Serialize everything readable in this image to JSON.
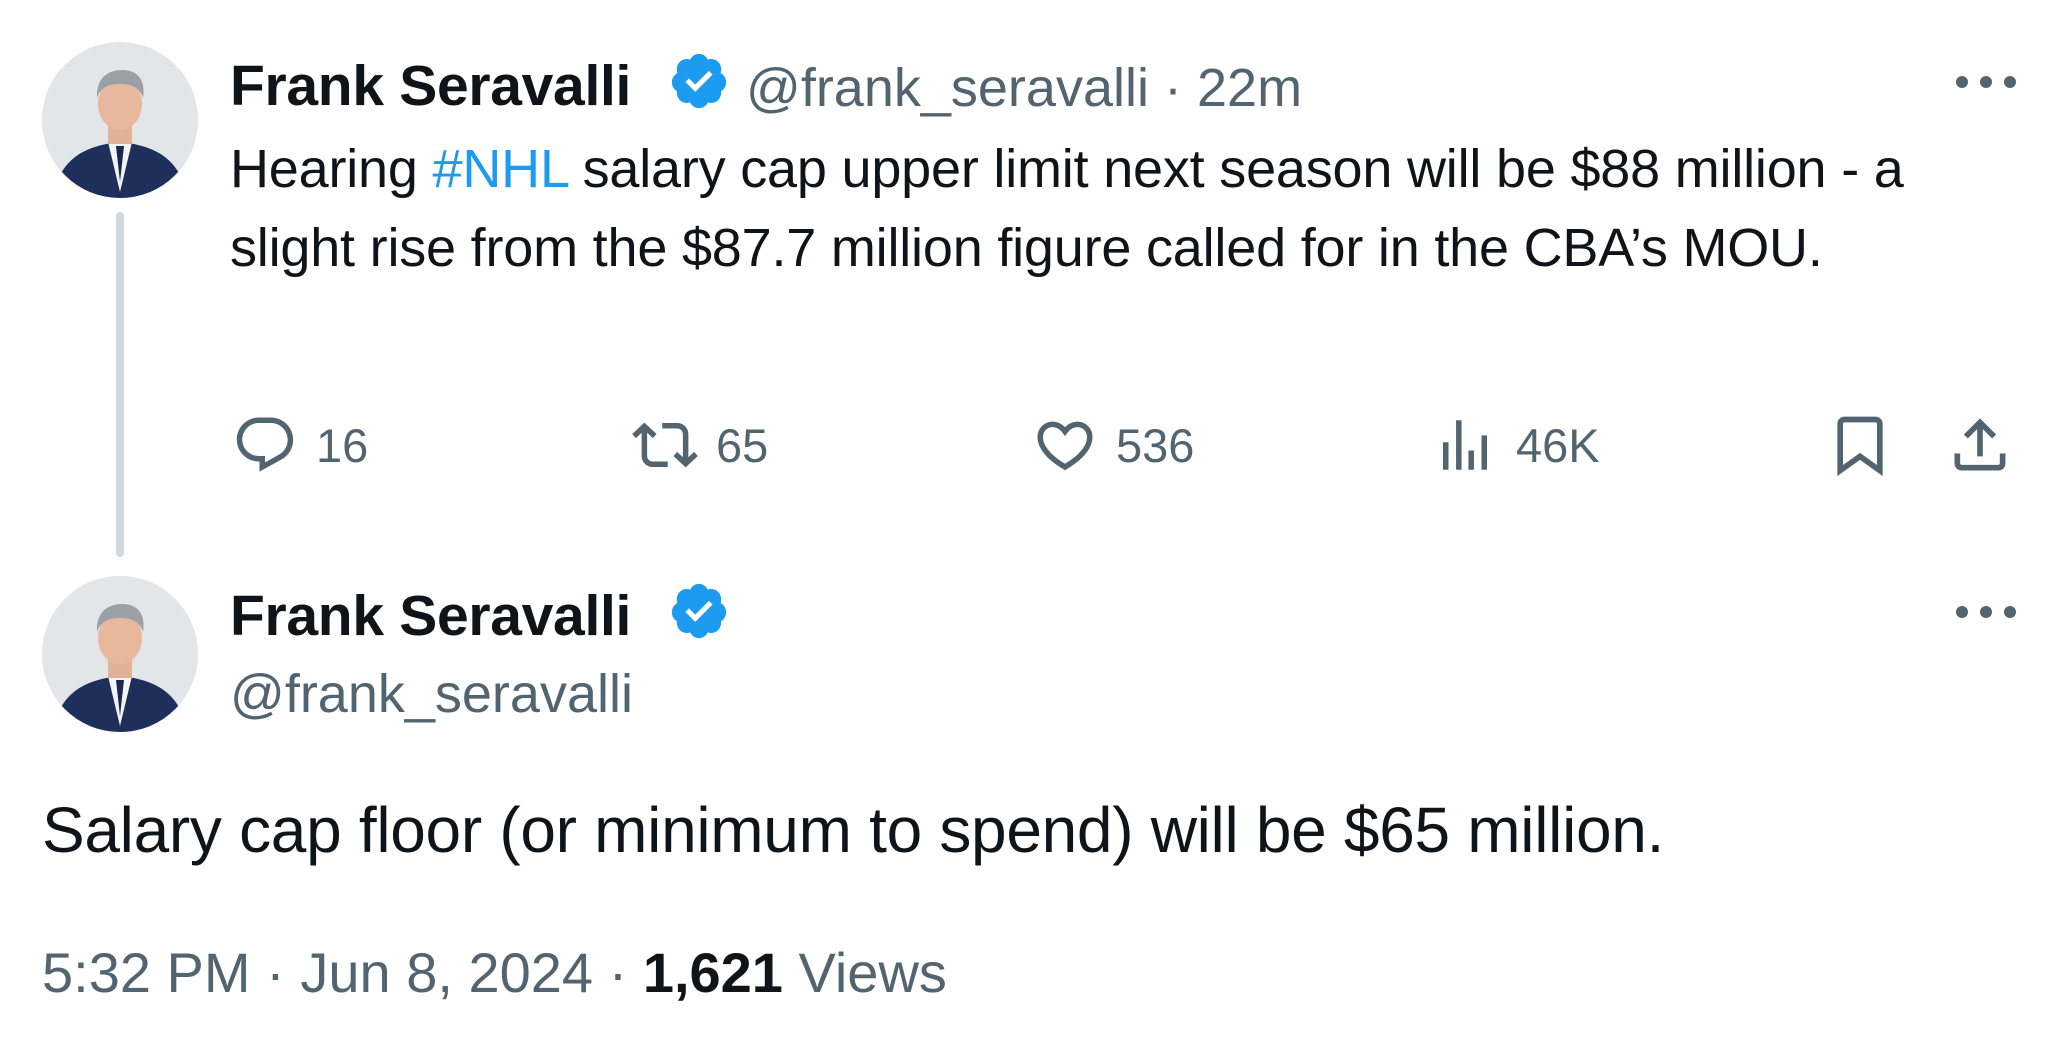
{
  "reply_tweet": {
    "author_name": "Frank Seravalli",
    "handle": "@frank_seravalli",
    "separator": "·",
    "time_ago": "22m",
    "text_before": "Hearing ",
    "hashtag": "#NHL",
    "text_after": " salary cap upper limit next season will be $88 million - a slight rise from the $87.7 million figure called for in the CBA’s MOU.",
    "actions": {
      "replies": "16",
      "reposts": "65",
      "likes": "536",
      "views": "46K"
    }
  },
  "main_tweet": {
    "author_name": "Frank Seravalli",
    "handle": "@frank_seravalli",
    "text": "Salary cap floor (or minimum to spend) will be $65 million.",
    "time": "5:32 PM",
    "date": "Jun 8, 2024",
    "separator": "·",
    "views_count": "1,621",
    "views_label": "Views"
  },
  "colors": {
    "text": "#0f1419",
    "secondary": "#536471",
    "link": "#1d9bf0",
    "verified": "#1d9bf0",
    "thread_line": "#cfd9de"
  },
  "icons": [
    "reply-icon",
    "repost-icon",
    "like-icon",
    "views-icon",
    "bookmark-icon",
    "share-icon",
    "verified-badge-icon",
    "more-icon"
  ]
}
